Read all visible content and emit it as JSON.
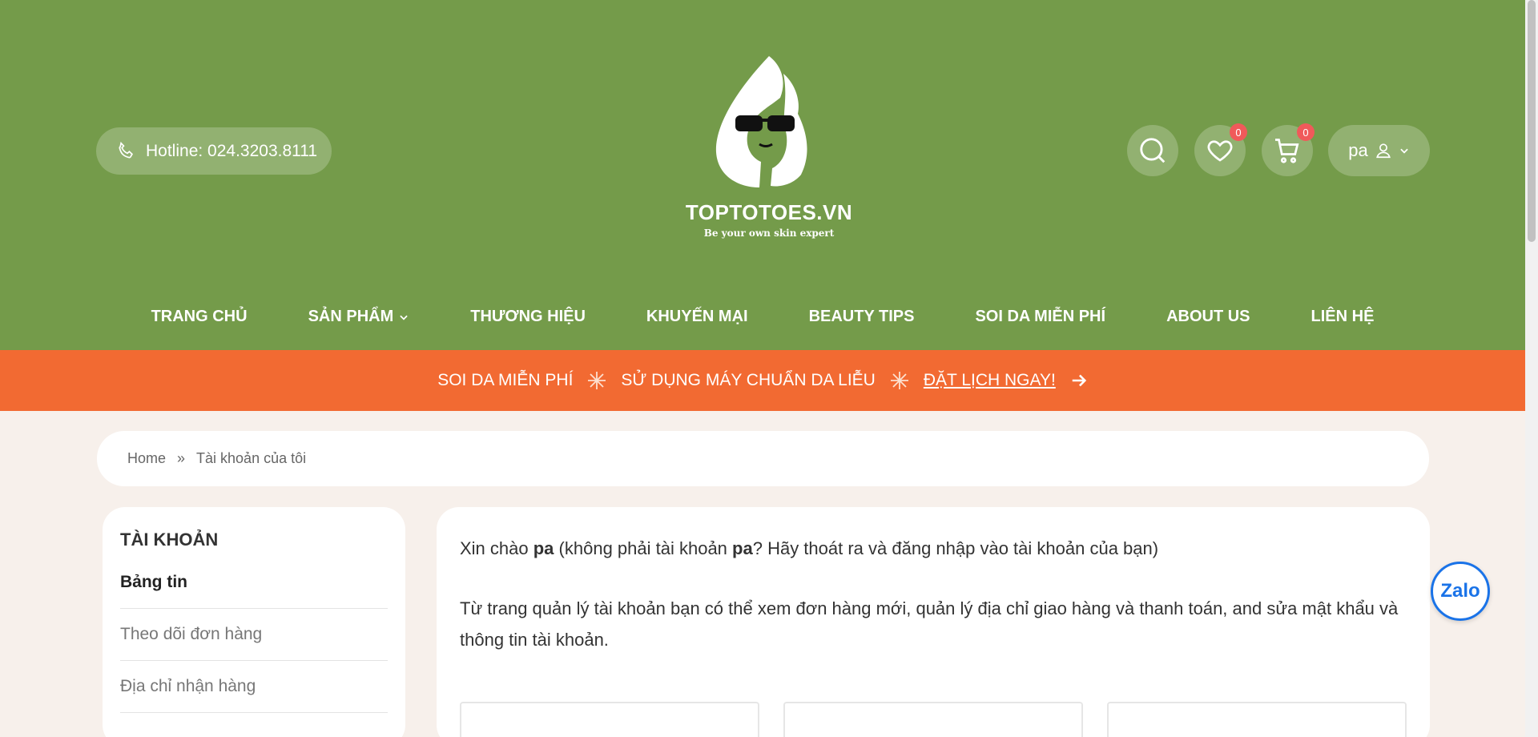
{
  "header": {
    "hotline_label": "Hotline: 024.3203.8111",
    "logo_text": "TOPTOTOES.VN",
    "logo_tagline": "Be your own skin expert",
    "wishlist_count": "0",
    "cart_count": "0",
    "user_label": "pa",
    "icons": [
      "phone-icon",
      "search-icon",
      "heart-icon",
      "cart-icon",
      "user-icon",
      "chevron-down-icon"
    ]
  },
  "nav": {
    "items": [
      {
        "label": "TRANG CHỦ"
      },
      {
        "label": "SẢN PHẨM"
      },
      {
        "label": "THƯƠNG HIỆU"
      },
      {
        "label": "KHUYẾN MẠI"
      },
      {
        "label": "BEAUTY TIPS"
      },
      {
        "label": "SOI DA MIỄN PHÍ"
      },
      {
        "label": "ABOUT US"
      },
      {
        "label": "LIÊN HỆ"
      }
    ]
  },
  "promo": {
    "part1": "SOI DA MIỄN PHÍ",
    "part2": "SỬ DỤNG MÁY CHUẨN DA LIỄU",
    "cta": "ĐẶT LỊCH NGAY!"
  },
  "breadcrumb": {
    "home": "Home",
    "separator": "»",
    "current": "Tài khoản của tôi"
  },
  "sidebar": {
    "title": "TÀI KHOẢN",
    "items": [
      {
        "label": "Bảng tin"
      },
      {
        "label": "Theo dõi đơn hàng"
      },
      {
        "label": "Địa chỉ nhận hàng"
      }
    ]
  },
  "main": {
    "greeting_prefix": "Xin chào ",
    "greeting_name": "pa",
    "greeting_mid": " (không phải tài khoản ",
    "greeting_name2": "pa",
    "greeting_suffix": "? Hãy thoát ra và đăng nhập vào tài khoản của bạn)",
    "description": "Từ trang quản lý tài khoản bạn có thể xem đơn hàng mới, quản lý địa chỉ giao hàng và thanh toán, and sửa mật khẩu và thông tin tài khoản."
  },
  "zalo": {
    "label": "Zalo"
  },
  "colors": {
    "header_green": "#749b4a",
    "promo_orange": "#f26a32",
    "page_bg": "#f7f0eb",
    "badge_red": "#f05a5a"
  }
}
